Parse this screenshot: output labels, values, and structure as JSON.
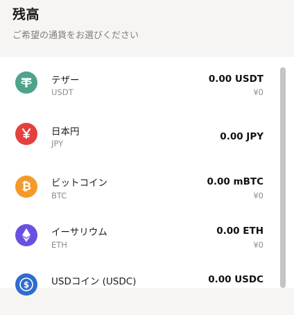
{
  "header": {
    "title": "残高",
    "subtitle": "ご希望の通貨をお選びください"
  },
  "currencies": [
    {
      "name": "テザー",
      "symbol": "USDT",
      "amount": "0.00 USDT",
      "jpy": "¥0",
      "icon": "tether-icon",
      "color": "#4fa38c"
    },
    {
      "name": "日本円",
      "symbol": "JPY",
      "amount": "0.00 JPY",
      "jpy": "",
      "icon": "yen-icon",
      "color": "#e34040"
    },
    {
      "name": "ビットコイン",
      "symbol": "BTC",
      "amount": "0.00 mBTC",
      "jpy": "¥0",
      "icon": "bitcoin-icon",
      "color": "#f39a2b"
    },
    {
      "name": "イーサリウム",
      "symbol": "ETH",
      "amount": "0.00 ETH",
      "jpy": "¥0",
      "icon": "ethereum-icon",
      "color": "#6b4fe0"
    },
    {
      "name": "USDコイン (USDC)",
      "symbol": "USDC",
      "amount": "0.00 USDC",
      "jpy": "",
      "icon": "usdc-icon",
      "color": "#2f6ccf"
    }
  ]
}
